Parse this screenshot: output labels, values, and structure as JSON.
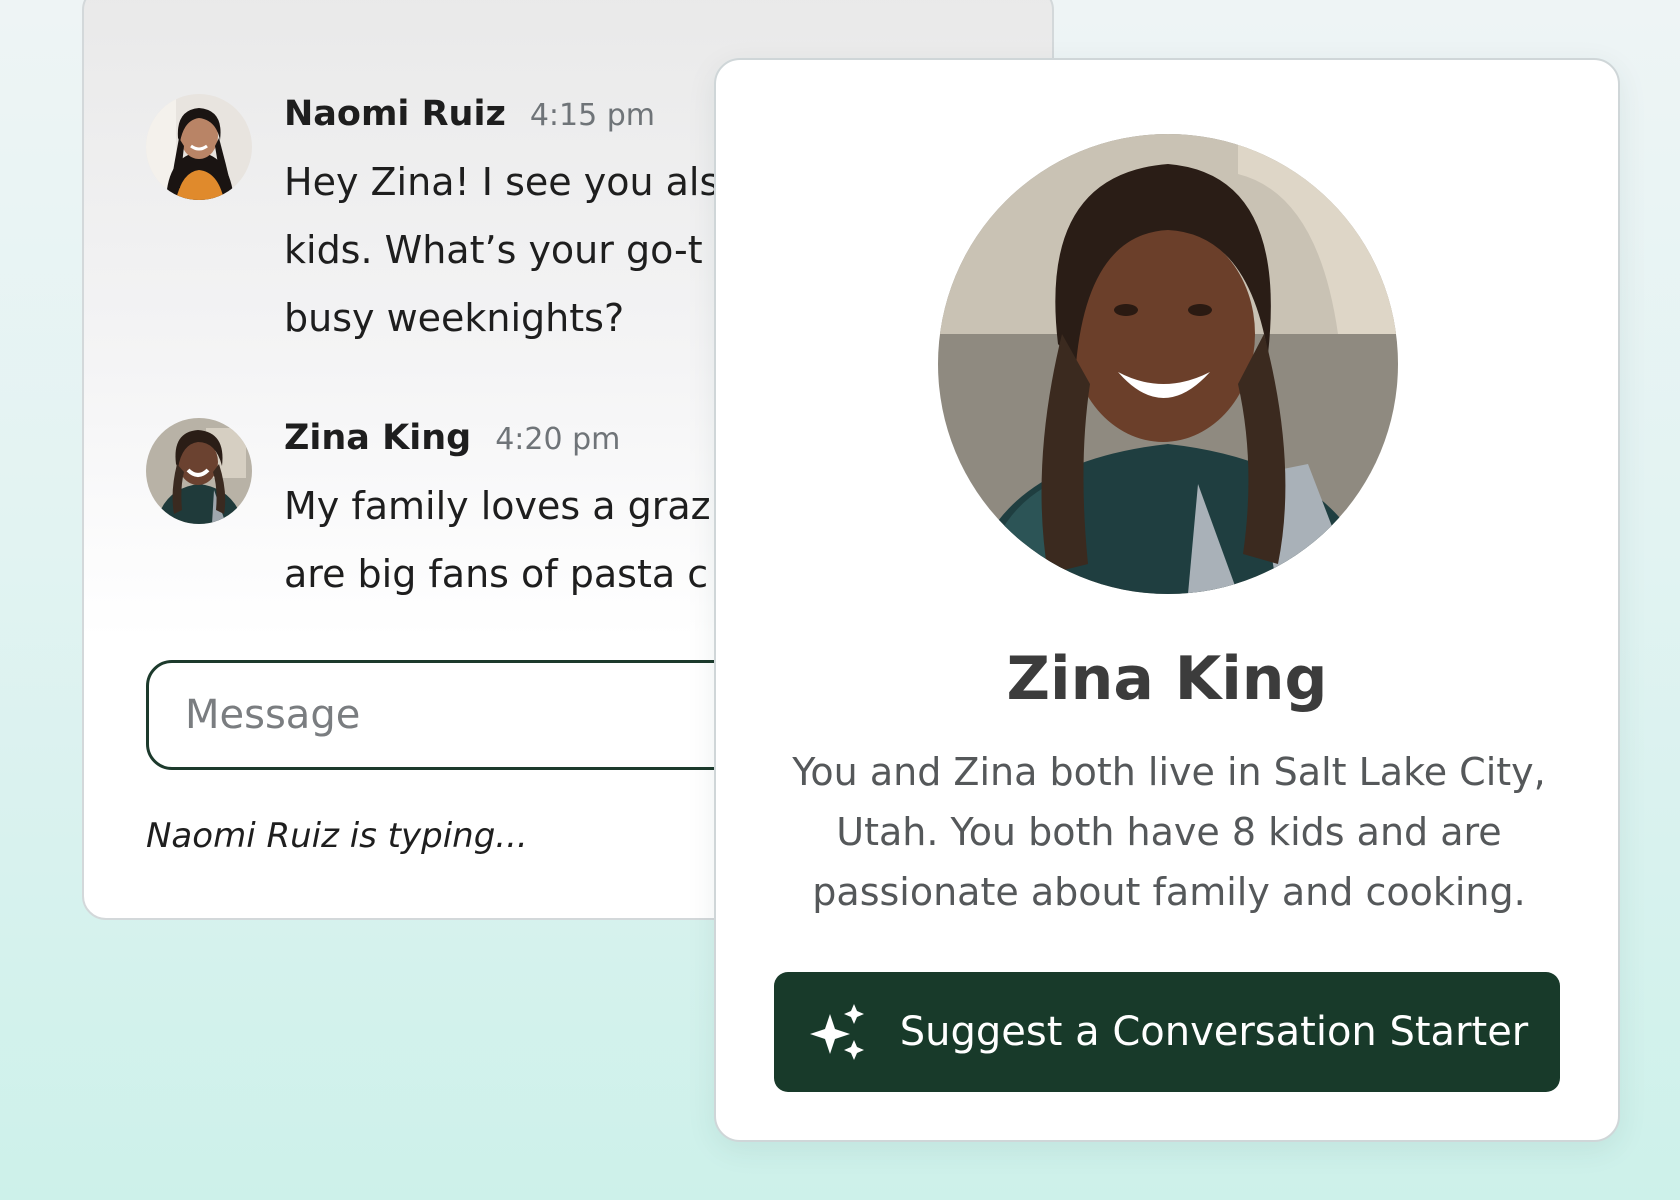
{
  "chat": {
    "messages": [
      {
        "author": "Naomi Ruiz",
        "time": "4:15 pm",
        "text": "Hey Zina! I see you als\nkids. What’s your go-t\nbusy weeknights?"
      },
      {
        "author": "Zina King",
        "time": "4:20 pm",
        "text": "My family loves a graz\nare big fans of pasta c"
      }
    ],
    "input": {
      "placeholder": "Message"
    },
    "typing_indicator": "Naomi Ruiz is typing..."
  },
  "profile": {
    "name": "Zina King",
    "description": "You and Zina both live in Salt Lake City, Utah. You both have 8 kids and are passionate about family and cooking.",
    "button_label": "Suggest a Conversation Starter",
    "button_icon": "sparkles-icon"
  },
  "colors": {
    "accent_dark_green": "#183a2a",
    "input_border": "#1c3a2c"
  }
}
